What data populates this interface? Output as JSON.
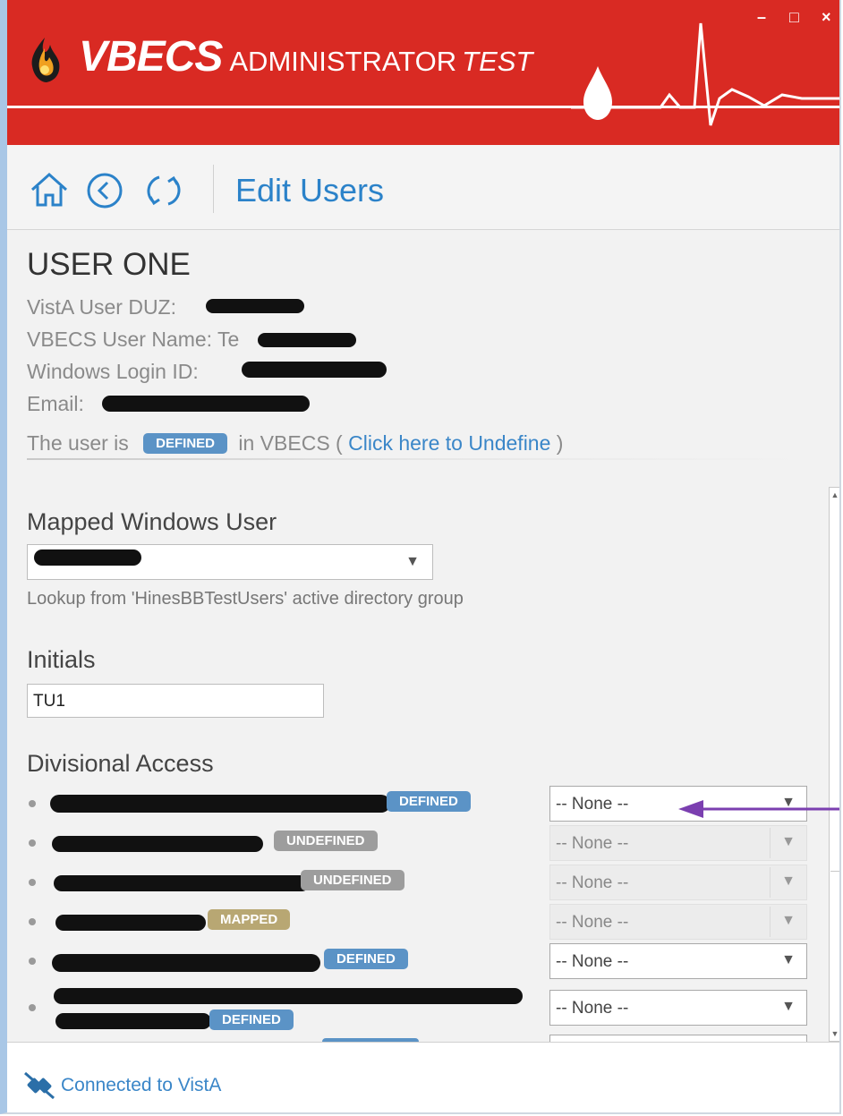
{
  "window": {
    "brand_bold": "VBECS",
    "brand_regular": "ADMINISTRATOR",
    "brand_italic": "TEST",
    "minimize_glyph": "–",
    "maximize_glyph": "□",
    "close_glyph": "×",
    "colors": {
      "header": "#d92a23",
      "accent": "#2b82c9"
    }
  },
  "toolbar": {
    "title": "Edit Users",
    "icons": [
      "home-icon",
      "back-icon",
      "refresh-icon"
    ]
  },
  "user": {
    "name": "USER ONE",
    "duz_label": "VistA User DUZ:",
    "vbecs_name_label": "VBECS User Name:",
    "vbecs_name_partial": "Te",
    "windows_login_label": "Windows Login ID:",
    "email_label": "Email:",
    "status_prefix": "The user is",
    "status_badge": "DEFINED",
    "status_mid": "in VBECS (",
    "status_link": "Click here to Undefine",
    "status_suffix": ")"
  },
  "mapped_windows_user": {
    "label": "Mapped Windows User",
    "help": "Lookup from 'HinesBBTestUsers' active directory group"
  },
  "initials": {
    "label": "Initials",
    "value": "TU1"
  },
  "divisional_access": {
    "label": "Divisional Access",
    "rows": [
      {
        "badge": "DEFINED",
        "select": "-- None --",
        "enabled": true
      },
      {
        "badge": "UNDEFINED",
        "select": "-- None --",
        "enabled": false
      },
      {
        "badge": "UNDEFINED",
        "select": "-- None --",
        "enabled": false
      },
      {
        "badge": "MAPPED",
        "select": "-- None --",
        "enabled": false
      },
      {
        "badge": "DEFINED",
        "select": "-- None --",
        "enabled": true
      },
      {
        "badge": "DEFINED",
        "select": "-- None --",
        "enabled": true
      }
    ]
  },
  "statusbar": {
    "text": "Connected to VistA",
    "icon": "plug-connected-icon"
  }
}
